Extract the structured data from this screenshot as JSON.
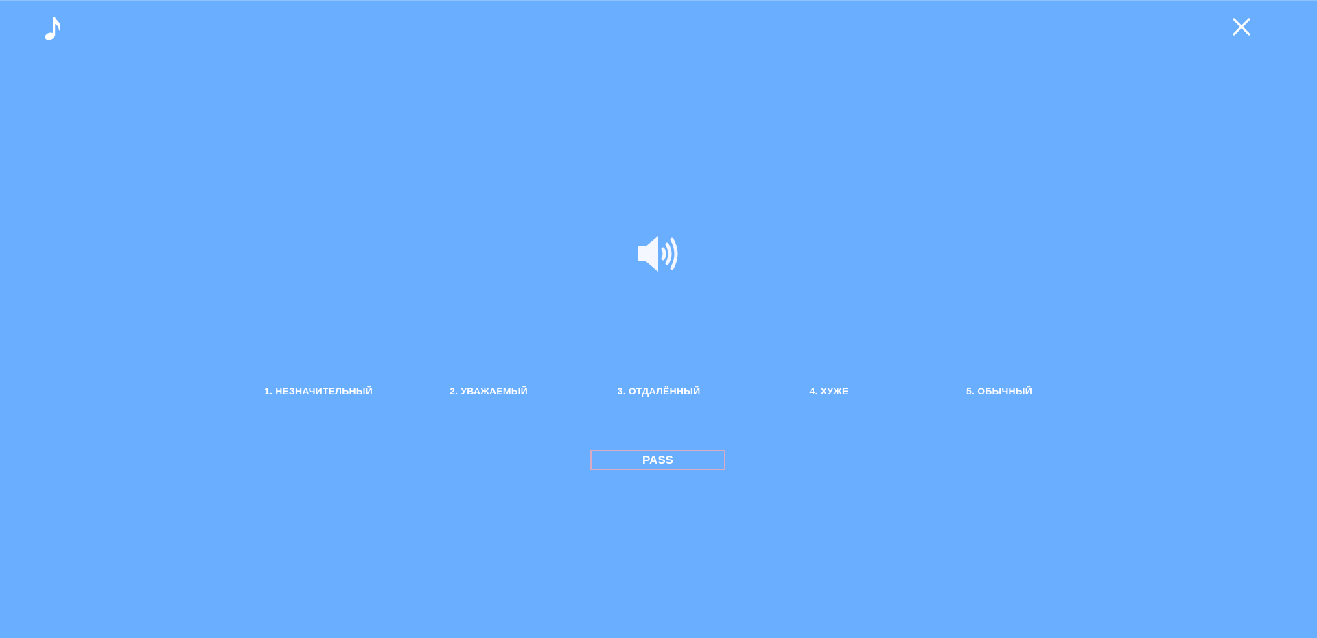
{
  "header": {
    "music_icon": "music-note-icon",
    "close_icon": "close-icon"
  },
  "main": {
    "speaker_icon": "speaker-volume-icon",
    "options": [
      {
        "label": "1. НЕЗНАЧИТЕЛЬНЫЙ"
      },
      {
        "label": "2. УВАЖАЕМЫЙ"
      },
      {
        "label": "3. ОТДАЛЁННЫЙ"
      },
      {
        "label": "4. ХУЖЕ"
      },
      {
        "label": "5. ОБЫЧНЫЙ"
      }
    ],
    "pass_label": "PASS"
  },
  "colors": {
    "background": "#6aaeff",
    "text": "#ffffff",
    "pass_border": "#d9a9c6",
    "speaker": "#f4f7ff"
  }
}
